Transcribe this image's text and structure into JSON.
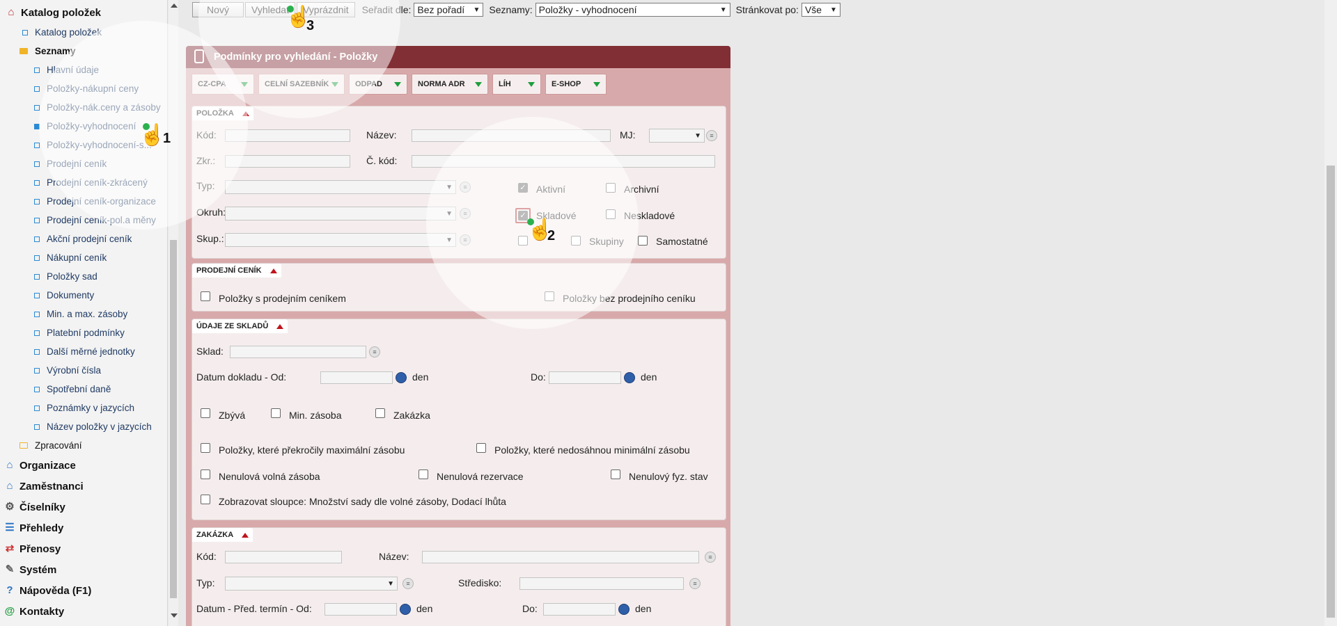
{
  "sidebar": {
    "top_title": "Katalog položek",
    "items": [
      {
        "label": "Katalog položek"
      },
      {
        "label": "Seznamy"
      },
      {
        "label": "Hlavní údaje"
      },
      {
        "label": "Položky-nákupní ceny"
      },
      {
        "label": "Položky-nák.ceny a zásoby"
      },
      {
        "label": "Položky-vyhodnocení"
      },
      {
        "label": "Položky-vyhodnocení-s..."
      },
      {
        "label": "Prodejní ceník"
      },
      {
        "label": "Prodejní ceník-zkrácený"
      },
      {
        "label": "Prodejní ceník-organizace"
      },
      {
        "label": "Prodejní ceník-pol.a měny"
      },
      {
        "label": "Akční prodejní ceník"
      },
      {
        "label": "Nákupní ceník"
      },
      {
        "label": "Položky sad"
      },
      {
        "label": "Dokumenty"
      },
      {
        "label": "Min. a max. zásoby"
      },
      {
        "label": "Platební podmínky"
      },
      {
        "label": "Další měrné jednotky"
      },
      {
        "label": "Výrobní čísla"
      },
      {
        "label": "Spotřební daně"
      },
      {
        "label": "Poznámky v jazycích"
      },
      {
        "label": "Název položky v jazycích"
      },
      {
        "label": "Zpracování"
      }
    ],
    "top_items": [
      {
        "label": "Organizace",
        "icon": "home-icon"
      },
      {
        "label": "Zaměstnanci",
        "icon": "people-icon"
      },
      {
        "label": "Číselníky",
        "icon": "gear-icon"
      },
      {
        "label": "Přehledy",
        "icon": "list-icon"
      },
      {
        "label": "Přenosy",
        "icon": "transfer-icon"
      },
      {
        "label": "Systém",
        "icon": "wrench-icon"
      },
      {
        "label": "Nápověda (F1)",
        "icon": "help-icon"
      },
      {
        "label": "Kontakty",
        "icon": "at-icon"
      }
    ]
  },
  "toolbar": {
    "new_label": "Nový",
    "search_label": "Vyhledat",
    "clear_label": "Vyprázdnit",
    "sort_label": "Seřadit dle:",
    "sort_value": "Bez pořadí",
    "lists_label": "Seznamy:",
    "lists_value": "Položky - vyhodnocení",
    "paging_label": "Stránkovat po:",
    "paging_value": "Vše"
  },
  "panel": {
    "title": "Podmínky pro vyhledání - Položky",
    "tabs": [
      "CZ-CPA",
      "CELNÍ SAZEBNÍK",
      "ODPAD",
      "NORMA ADR",
      "LÍH",
      "E-SHOP"
    ]
  },
  "polozka": {
    "title": "POLOŽKA",
    "kod": "Kód:",
    "nazev": "Název:",
    "mj": "MJ:",
    "zkr": "Zkr.:",
    "c_kod": "Č. kód:",
    "typ": "Typ:",
    "okruh": "Okruh:",
    "skup": "Skup.:",
    "aktivni": "Aktivní",
    "archivni": "Archivní",
    "skladove": "Skladové",
    "neskladove": "Neskladové",
    "skupiny": "Skupiny",
    "samostatne": "Samostatné"
  },
  "cenik": {
    "title": "PRODEJNÍ CENÍK",
    "with": "Položky s prodejním ceníkem",
    "without": "Položky bez prodejního ceníku"
  },
  "sklad": {
    "title": "ÚDAJE ZE SKLADŮ",
    "sklad": "Sklad:",
    "datum_od": "Datum dokladu - Od:",
    "den": "den",
    "do": "Do:",
    "zbyva": "Zbývá",
    "min_zasoba": "Min. zásoba",
    "zakazka": "Zakázka",
    "over_max": "Položky, které překročily maximální zásobu",
    "under_min": "Položky, které nedosáhnou minimální zásobu",
    "nenul_volna": "Nenulová volná zásoba",
    "nenul_rez": "Nenulová rezervace",
    "nenul_fyz": "Nenulový fyz. stav",
    "show_cols": "Zobrazovat sloupce: Množství sady dle volné zásoby, Dodací lhůta"
  },
  "zakazka": {
    "title": "ZAKÁZKA",
    "kod": "Kód:",
    "nazev": "Název:",
    "typ": "Typ:",
    "stredisko": "Středisko:",
    "datum_od": "Datum - Před. termín - Od:",
    "den": "den",
    "do": "Do:"
  },
  "annotations": {
    "step1": "1",
    "step2": "2",
    "step3": "3"
  }
}
